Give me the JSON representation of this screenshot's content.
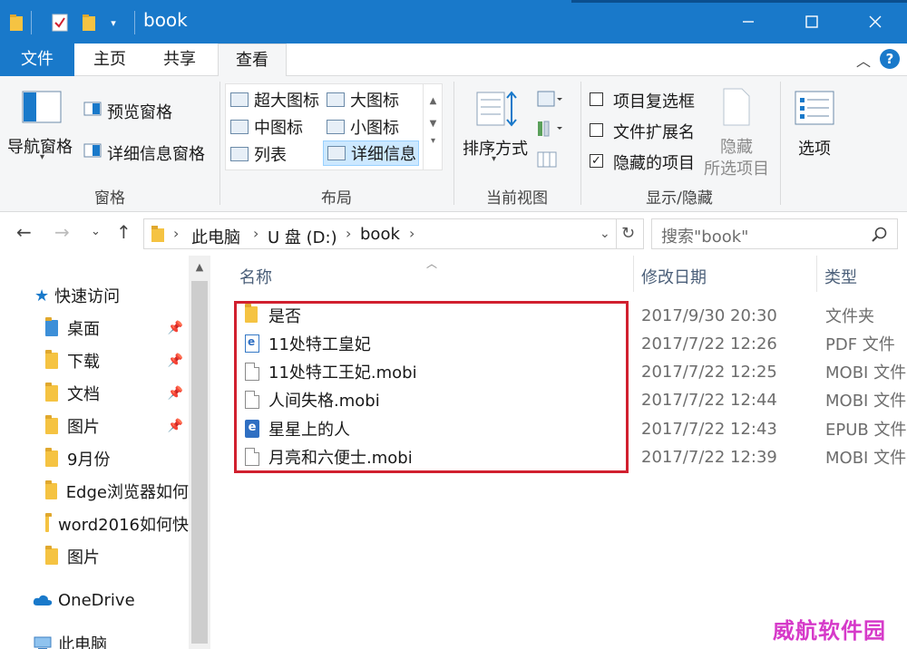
{
  "window": {
    "title": "book",
    "accent": "#1979ca"
  },
  "tabs": [
    {
      "label": "文件"
    },
    {
      "label": "主页"
    },
    {
      "label": "共享"
    },
    {
      "label": "查看"
    }
  ],
  "ribbon": {
    "panes": {
      "nav_pane": "导航窗格",
      "preview_pane": "预览窗格",
      "details_pane": "详细信息窗格",
      "group_label": "窗格"
    },
    "layout": {
      "items": [
        "超大图标",
        "大图标",
        "中图标",
        "小图标",
        "列表",
        "详细信息"
      ],
      "selected": "详细信息",
      "group_label": "布局"
    },
    "current_view": {
      "sort_by": "排序方式",
      "group_label": "当前视图"
    },
    "show_hide": {
      "item_checkboxes": "项目复选框",
      "file_extensions": "文件扩展名",
      "hidden_items": "隐藏的项目",
      "hide_selected_line1": "隐藏",
      "hide_selected_line2": "所选项目",
      "group_label": "显示/隐藏"
    },
    "options": "选项"
  },
  "address": {
    "crumbs": [
      "此电脑",
      "U 盘 (D:)",
      "book"
    ],
    "search_placeholder": "搜索\"book\""
  },
  "nav": {
    "quick_access": "快速访问",
    "items": [
      "桌面",
      "下载",
      "文档",
      "图片",
      "9月份",
      "Edge浏览器如何",
      "word2016如何快",
      "图片"
    ],
    "onedrive": "OneDrive",
    "this_pc": "此电脑"
  },
  "columns": {
    "name": "名称",
    "date": "修改日期",
    "type": "类型"
  },
  "files": [
    {
      "name": "是否",
      "date": "2017/9/30 20:30",
      "type": "文件夹",
      "icon": "folder-icon"
    },
    {
      "name": "11处特工皇妃",
      "date": "2017/7/22 12:26",
      "type": "PDF 文件",
      "icon": "pdf-icon"
    },
    {
      "name": "11处特工王妃.mobi",
      "date": "2017/7/22 12:25",
      "type": "MOBI 文件",
      "icon": "file-icon"
    },
    {
      "name": "人间失格.mobi",
      "date": "2017/7/22 12:44",
      "type": "MOBI 文件",
      "icon": "file-icon"
    },
    {
      "name": "星星上的人",
      "date": "2017/7/22 12:43",
      "type": "EPUB 文件",
      "icon": "epub-icon"
    },
    {
      "name": "月亮和六便士.mobi",
      "date": "2017/7/22 12:39",
      "type": "MOBI 文件",
      "icon": "file-icon"
    }
  ],
  "watermark": "威航软件园"
}
